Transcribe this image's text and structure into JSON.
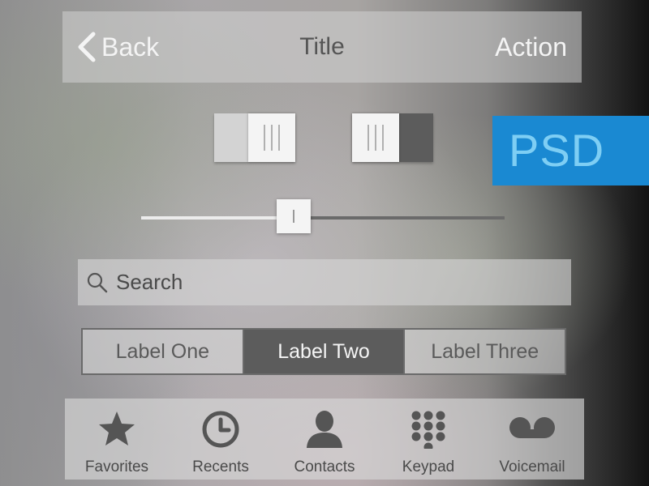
{
  "navbar": {
    "back_label": "Back",
    "title": "Title",
    "action_label": "Action",
    "back_icon": "chevron-left-icon"
  },
  "toggles": [
    {
      "state": "on"
    },
    {
      "state": "off"
    }
  ],
  "badge": {
    "text": "PSD",
    "color": "#1a89d2",
    "text_color": "#7ecef4"
  },
  "slider": {
    "value": 0.42
  },
  "search": {
    "placeholder": "Search",
    "value": "",
    "icon": "search-icon"
  },
  "segmented": {
    "segments": [
      "Label One",
      "Label Two",
      "Label Three"
    ],
    "selected_index": 1
  },
  "tabbar": {
    "tabs": [
      {
        "label": "Favorites",
        "icon": "star-icon"
      },
      {
        "label": "Recents",
        "icon": "clock-icon"
      },
      {
        "label": "Contacts",
        "icon": "person-icon"
      },
      {
        "label": "Keypad",
        "icon": "keypad-icon"
      },
      {
        "label": "Voicemail",
        "icon": "voicemail-icon"
      }
    ]
  },
  "colors": {
    "icon_dark": "#555555",
    "control_light": "#f4f4f4",
    "control_dark": "#5c5c5c"
  }
}
